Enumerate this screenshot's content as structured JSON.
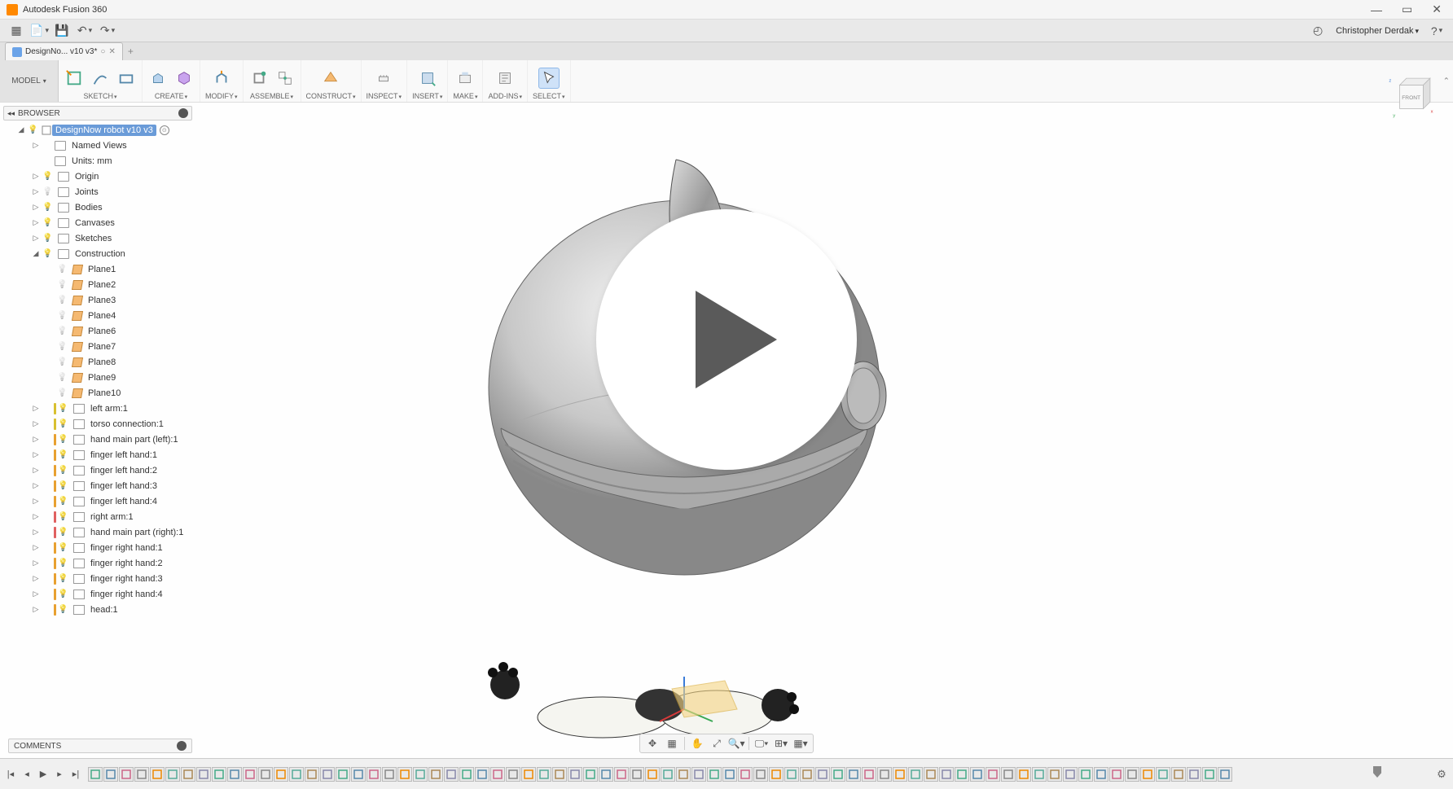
{
  "window": {
    "title": "Autodesk Fusion 360"
  },
  "topbar": {
    "user": "Christopher Derdak"
  },
  "tab": {
    "name": "DesignNo... v10 v3*",
    "unsaved": "○"
  },
  "ribbon": {
    "mode": "MODEL",
    "groups": [
      {
        "id": "sketch",
        "label": "SKETCH"
      },
      {
        "id": "create",
        "label": "CREATE"
      },
      {
        "id": "modify",
        "label": "MODIFY"
      },
      {
        "id": "assemble",
        "label": "ASSEMBLE"
      },
      {
        "id": "construct",
        "label": "CONSTRUCT"
      },
      {
        "id": "inspect",
        "label": "INSPECT"
      },
      {
        "id": "insert",
        "label": "INSERT"
      },
      {
        "id": "make",
        "label": "MAKE"
      },
      {
        "id": "addins",
        "label": "ADD-INS"
      },
      {
        "id": "select",
        "label": "SELECT"
      }
    ]
  },
  "browser": {
    "title": "BROWSER",
    "root": "DesignNow robot v10 v3",
    "items": [
      {
        "indent": 2,
        "type": "folder",
        "label": "Named Views",
        "expandable": true
      },
      {
        "indent": 2,
        "type": "folder",
        "label": "Units: mm"
      },
      {
        "indent": 2,
        "type": "folder",
        "label": "Origin",
        "expandable": true,
        "bulb": true
      },
      {
        "indent": 2,
        "type": "folder",
        "label": "Joints",
        "expandable": true,
        "bulbOff": true
      },
      {
        "indent": 2,
        "type": "folder",
        "label": "Bodies",
        "expandable": true,
        "bulb": true
      },
      {
        "indent": 2,
        "type": "folder",
        "label": "Canvases",
        "expandable": true,
        "bulb": true
      },
      {
        "indent": 2,
        "type": "folder",
        "label": "Sketches",
        "expandable": true,
        "bulb": true
      },
      {
        "indent": 2,
        "type": "folder",
        "label": "Construction",
        "expanded": true,
        "bulb": true
      },
      {
        "indent": 3,
        "type": "plane",
        "label": "Plane1",
        "bulbOff": true
      },
      {
        "indent": 3,
        "type": "plane",
        "label": "Plane2",
        "bulbOff": true
      },
      {
        "indent": 3,
        "type": "plane",
        "label": "Plane3",
        "bulbOff": true
      },
      {
        "indent": 3,
        "type": "plane",
        "label": "Plane4",
        "bulbOff": true
      },
      {
        "indent": 3,
        "type": "plane",
        "label": "Plane6",
        "bulbOff": true
      },
      {
        "indent": 3,
        "type": "plane",
        "label": "Plane7",
        "bulbOff": true
      },
      {
        "indent": 3,
        "type": "plane",
        "label": "Plane8",
        "bulbOff": true
      },
      {
        "indent": 3,
        "type": "plane",
        "label": "Plane9",
        "bulbOff": true
      },
      {
        "indent": 3,
        "type": "plane",
        "label": "Plane10",
        "bulbOff": true
      },
      {
        "indent": 2,
        "type": "comp",
        "label": "left arm:1",
        "bar": "#d8c030",
        "expandable": true
      },
      {
        "indent": 2,
        "type": "comp",
        "label": "torso connection:1",
        "bar": "#d8c030",
        "expandable": true
      },
      {
        "indent": 2,
        "type": "comp",
        "label": "hand main part (left):1",
        "bar": "#e8a030",
        "expandable": true
      },
      {
        "indent": 2,
        "type": "comp",
        "label": "finger left hand:1",
        "bar": "#e8a030",
        "expandable": true
      },
      {
        "indent": 2,
        "type": "comp",
        "label": "finger left hand:2",
        "bar": "#e8a030",
        "expandable": true
      },
      {
        "indent": 2,
        "type": "comp",
        "label": "finger left hand:3",
        "bar": "#e8a030",
        "expandable": true
      },
      {
        "indent": 2,
        "type": "comp",
        "label": "finger left hand:4",
        "bar": "#e8a030",
        "expandable": true
      },
      {
        "indent": 2,
        "type": "comp",
        "label": "right arm:1",
        "bar": "#e06060",
        "expandable": true
      },
      {
        "indent": 2,
        "type": "comp",
        "label": "hand main part (right):1",
        "bar": "#e06060",
        "expandable": true
      },
      {
        "indent": 2,
        "type": "comp",
        "label": "finger right hand:1",
        "bar": "#e8a030",
        "expandable": true
      },
      {
        "indent": 2,
        "type": "comp",
        "label": "finger right hand:2",
        "bar": "#e8a030",
        "expandable": true
      },
      {
        "indent": 2,
        "type": "comp",
        "label": "finger right hand:3",
        "bar": "#e8a030",
        "expandable": true
      },
      {
        "indent": 2,
        "type": "comp",
        "label": "finger right hand:4",
        "bar": "#e8a030",
        "expandable": true
      },
      {
        "indent": 2,
        "type": "comp",
        "label": "head:1",
        "bar": "#e8a030",
        "expandable": true
      }
    ]
  },
  "comments": {
    "title": "COMMENTS"
  },
  "viewcube": {
    "face": "FRONT",
    "axes": [
      "x",
      "y",
      "z"
    ]
  },
  "timeline_feature_count": 74
}
